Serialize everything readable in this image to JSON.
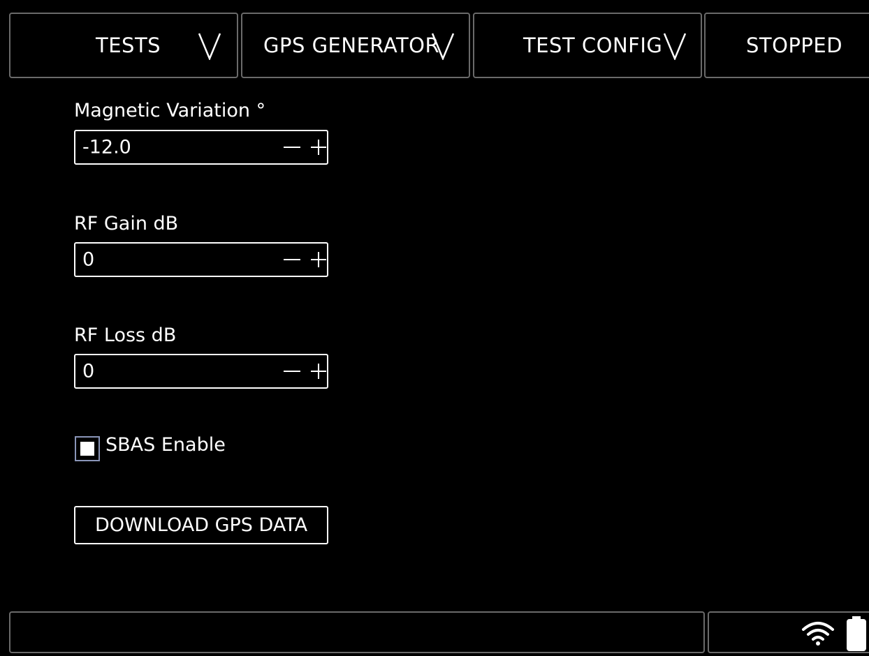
{
  "top_bar": {
    "tests_label": "TESTS",
    "gps_generator_label": "GPS GENERATOR",
    "test_config_label": "TEST CONFIG",
    "status_label": "STOPPED"
  },
  "fields": {
    "magnetic_variation": {
      "label": "Magnetic Variation °",
      "value": "-12.0"
    },
    "rf_gain": {
      "label": "RF Gain dB",
      "value": "0"
    },
    "rf_loss": {
      "label": "RF Loss dB",
      "value": "0"
    }
  },
  "sbas": {
    "label": "SBAS Enable",
    "checked": true
  },
  "download_button": {
    "label": "DOWNLOAD GPS DATA"
  },
  "status_bar": {
    "icons": [
      "wifi-icon",
      "battery-icon"
    ]
  },
  "colors": {
    "background": "#000000",
    "text": "#ffffff",
    "border": "#6a6a6a",
    "checkbox_border": "#8a95b8"
  }
}
